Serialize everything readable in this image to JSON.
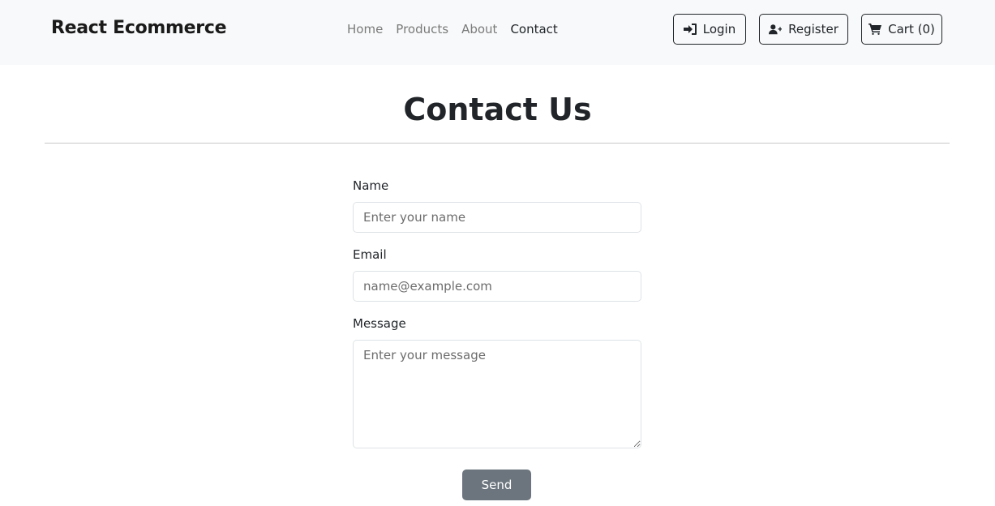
{
  "navbar": {
    "brand": "React Ecommerce",
    "links": [
      {
        "label": "Home",
        "active": false
      },
      {
        "label": "Products",
        "active": false
      },
      {
        "label": "About",
        "active": false
      },
      {
        "label": "Contact",
        "active": true
      }
    ],
    "buttons": {
      "login": "Login",
      "register": "Register",
      "cart": "Cart (0)"
    }
  },
  "page": {
    "title": "Contact Us"
  },
  "form": {
    "name": {
      "label": "Name",
      "placeholder": "Enter your name",
      "value": ""
    },
    "email": {
      "label": "Email",
      "placeholder": "name@example.com",
      "value": ""
    },
    "message": {
      "label": "Message",
      "placeholder": "Enter your message",
      "value": ""
    },
    "submit_label": "Send"
  }
}
